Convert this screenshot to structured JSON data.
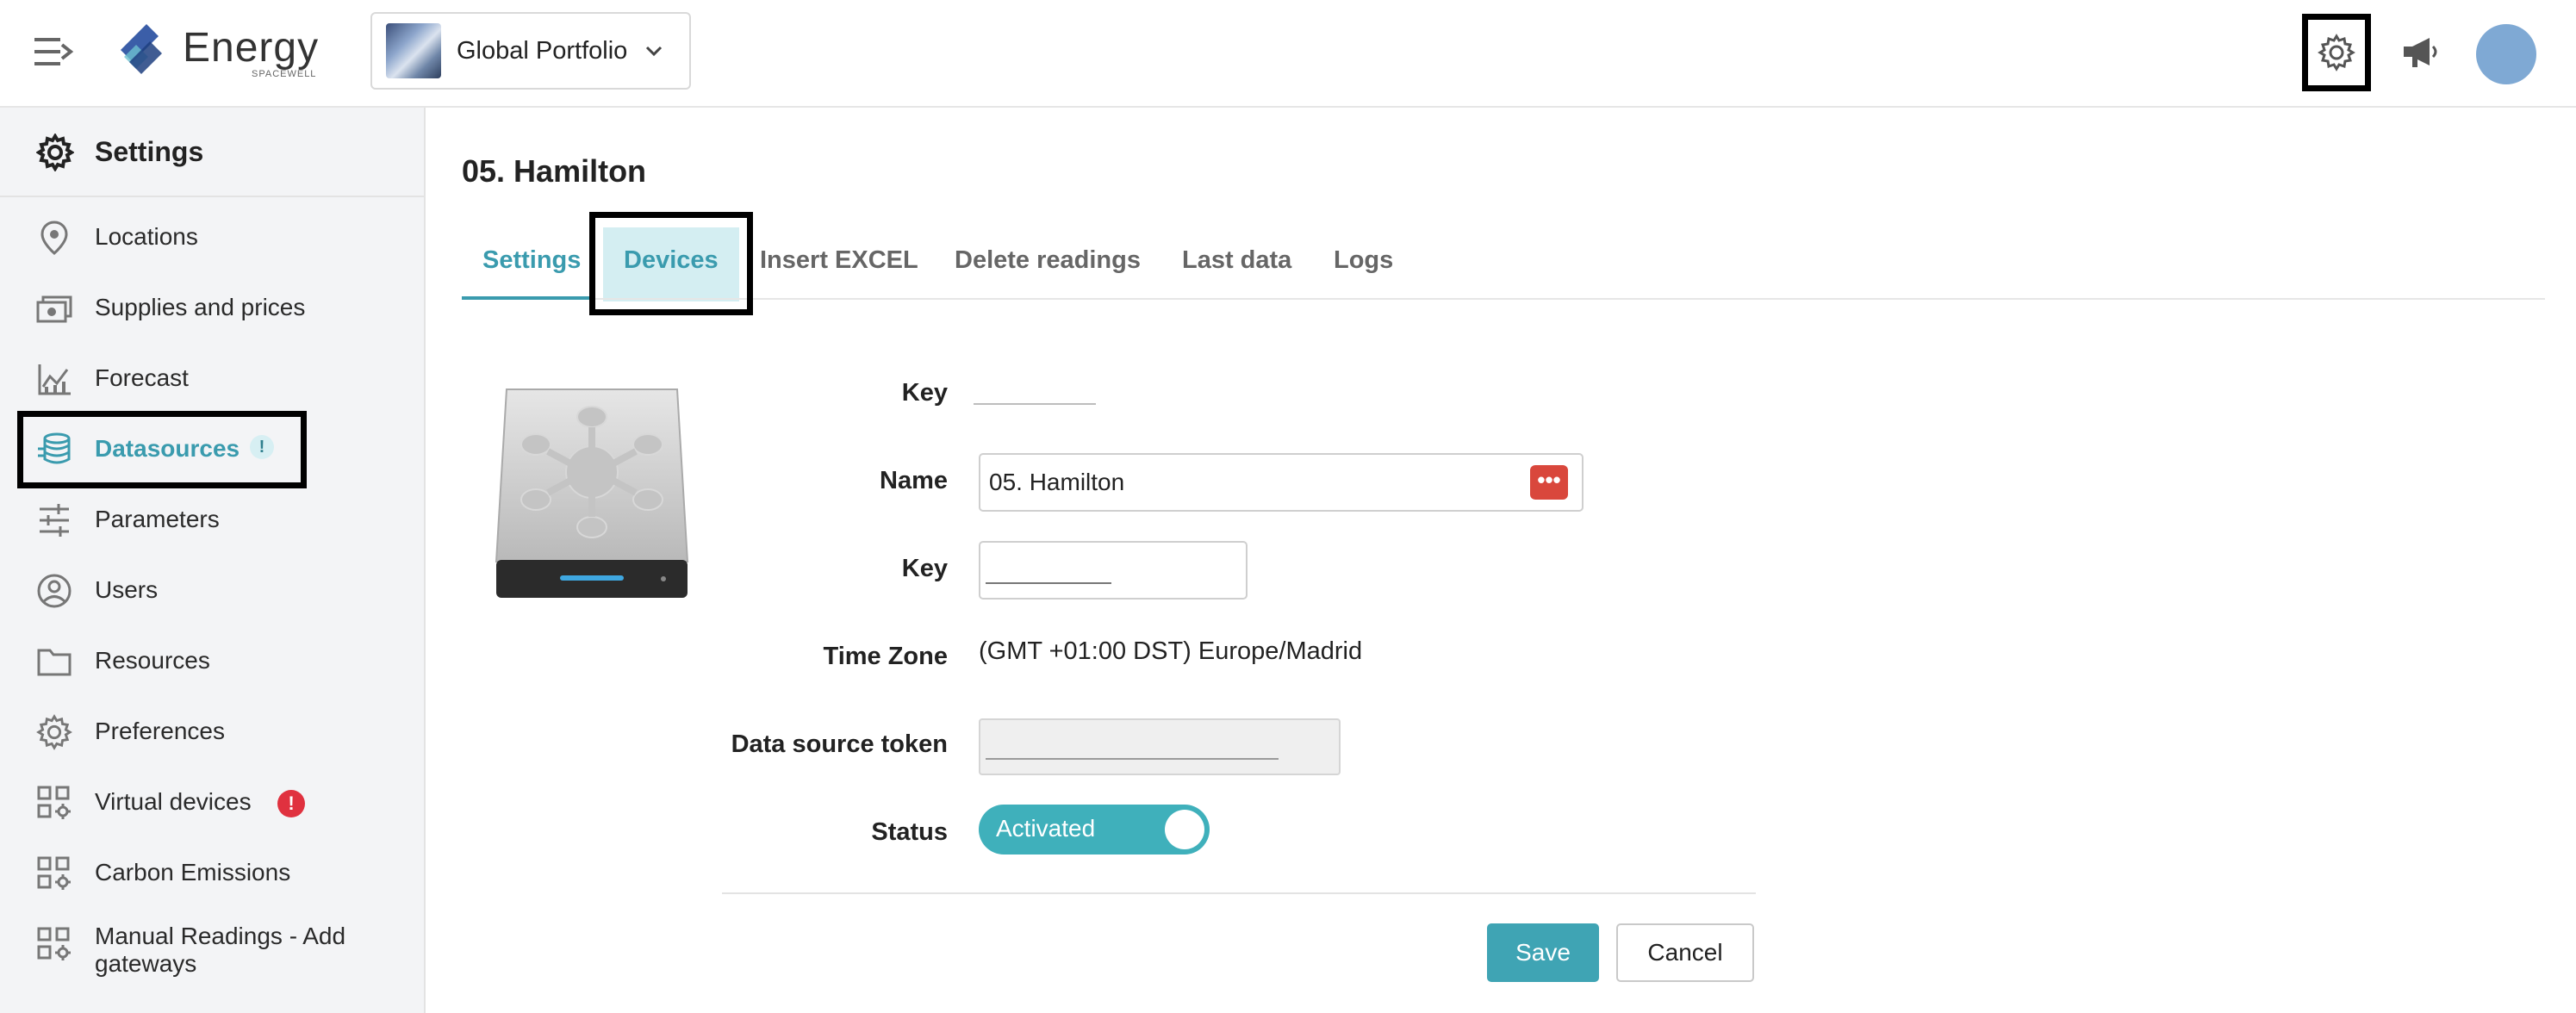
{
  "header": {
    "logo_text": "Energy",
    "logo_sub": "SPACEWELL",
    "portfolio_label": "Global Portfolio",
    "icons": [
      "menu-icon",
      "gear-icon",
      "megaphone-icon",
      "avatar"
    ]
  },
  "sidebar": {
    "title": "Settings",
    "items": [
      {
        "label": "Locations",
        "icon": "location-pin-icon"
      },
      {
        "label": "Supplies and prices",
        "icon": "money-icon"
      },
      {
        "label": "Forecast",
        "icon": "chart-icon"
      },
      {
        "label": "Datasources",
        "icon": "database-icon",
        "badge": "!"
      },
      {
        "label": "Parameters",
        "icon": "sliders-icon"
      },
      {
        "label": "Users",
        "icon": "user-circle-icon"
      },
      {
        "label": "Resources",
        "icon": "folder-icon"
      },
      {
        "label": "Preferences",
        "icon": "gear-icon"
      },
      {
        "label": "Virtual devices",
        "icon": "grid-gear-icon",
        "badge": "!"
      },
      {
        "label": "Carbon Emissions",
        "icon": "grid-gear-icon"
      },
      {
        "label": "Manual Readings - Add gateways",
        "icon": "grid-gear-icon"
      }
    ]
  },
  "main": {
    "title": "05. Hamilton",
    "tabs": [
      "Settings",
      "Devices",
      "Insert EXCEL",
      "Delete readings",
      "Last data",
      "Logs"
    ],
    "form": {
      "key_label": "Key",
      "name_label": "Name",
      "name_value": "05. Hamilton",
      "dots": "•••",
      "key2_label": "Key",
      "timezone_label": "Time Zone",
      "timezone_value": "(GMT +01:00 DST) Europe/Madrid",
      "token_label": "Data source token",
      "status_label": "Status",
      "status_value": "Activated"
    },
    "buttons": {
      "save": "Save",
      "cancel": "Cancel"
    }
  },
  "colors": {
    "accent": "#3a9bae",
    "toggle": "#3fb0bb",
    "alert": "#e0313f",
    "sidebar_bg": "#f3f4f6"
  }
}
